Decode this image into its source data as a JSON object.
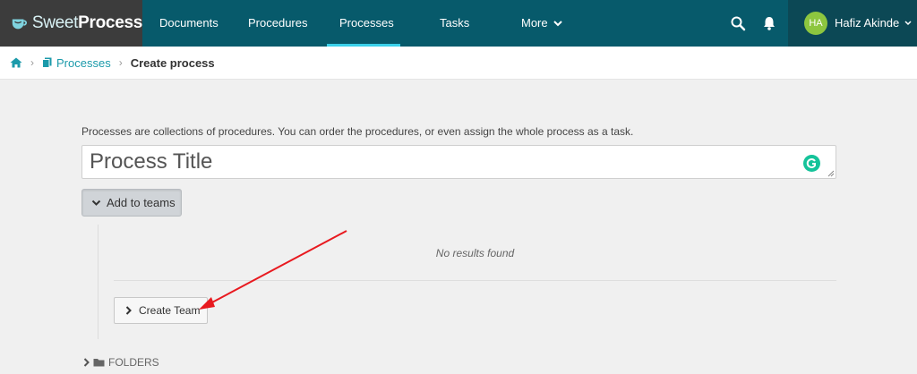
{
  "logo": {
    "text_light": "Sweet",
    "text_bold": "Process"
  },
  "nav": {
    "items": [
      {
        "label": "Documents"
      },
      {
        "label": "Procedures"
      },
      {
        "label": "Processes"
      },
      {
        "label": "Tasks"
      },
      {
        "label": "More"
      }
    ],
    "active": "Processes",
    "search_icon": "search-icon",
    "notification_icon": "bell-icon"
  },
  "user": {
    "initials": "HA",
    "name": "Hafiz Akinde",
    "avatar_color": "#8dc63f"
  },
  "breadcrumb": {
    "home_icon": "home-icon",
    "processes": "Processes",
    "current": "Create process"
  },
  "main": {
    "intro": "Processes are collections of procedures. You can order the procedures, or even assign the whole process as a task.",
    "title_placeholder": "Process Title",
    "add_to_teams_label": "Add to teams",
    "no_results": "No results found",
    "create_team_label": "Create Team",
    "folders_label": "FOLDERS"
  },
  "colors": {
    "nav_bg": "#075a6b",
    "accent": "#3ad1ea",
    "link": "#1b9aaa",
    "annotation_arrow": "#e8191f"
  }
}
